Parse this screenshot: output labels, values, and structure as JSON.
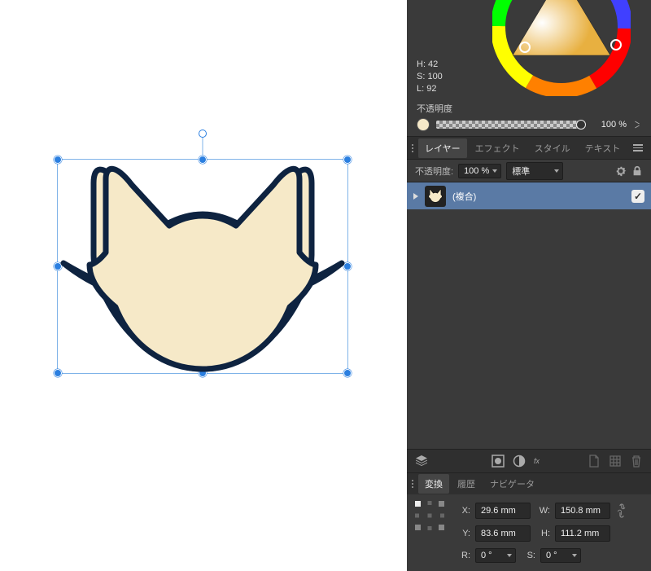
{
  "colors": {
    "shape_fill": "#f6e9c8",
    "shape_stroke": "#0e2340",
    "selection": "#2b7fe0"
  },
  "color_panel": {
    "h_label": "H: 42",
    "s_label": "S: 100",
    "l_label": "L: 92",
    "opacity_label": "不透明度",
    "opacity_value": "100 %"
  },
  "layer_tabs": {
    "items": [
      "レイヤー",
      "エフェクト",
      "スタイル",
      "テキスト"
    ],
    "active": 0
  },
  "layer_options": {
    "opacity_label": "不透明度:",
    "opacity_value": "100 %",
    "blend_mode": "標準"
  },
  "layers": [
    {
      "name": "(複合)",
      "visible": true
    }
  ],
  "transform_tabs": {
    "items": [
      "変換",
      "履歴",
      "ナビゲータ"
    ],
    "active": 0
  },
  "transform": {
    "x_label": "X:",
    "x_value": "29.6 mm",
    "y_label": "Y:",
    "y_value": "83.6 mm",
    "w_label": "W:",
    "w_value": "150.8 mm",
    "h_label": "H:",
    "h_value": "111.2 mm",
    "r_label": "R:",
    "r_value": "0 °",
    "s_label": "S:",
    "s_value": "0 °"
  }
}
